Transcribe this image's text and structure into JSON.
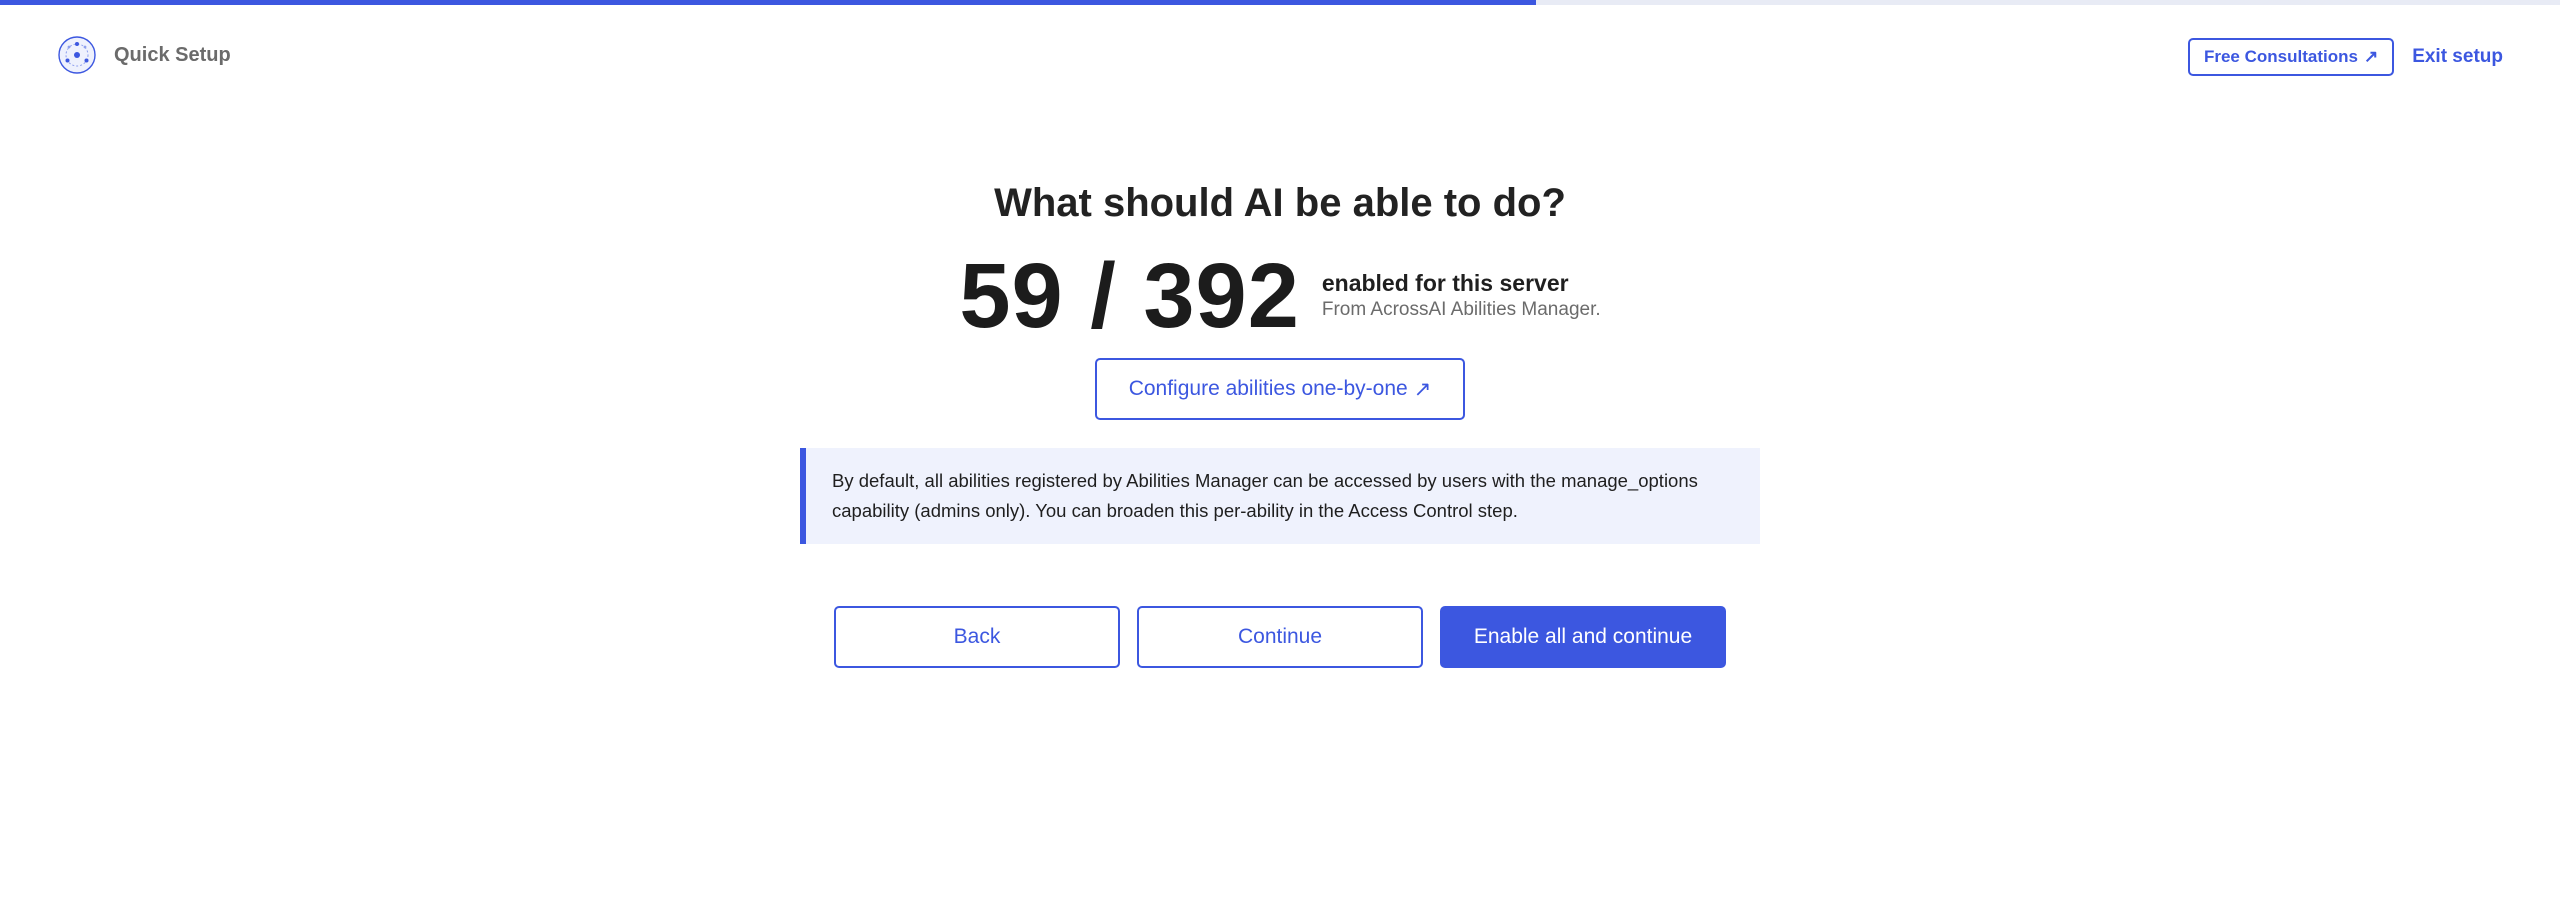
{
  "progress": {
    "fraction": 0.6
  },
  "header": {
    "logo_icon": "network-circle-icon",
    "title": "Quick Setup",
    "consult_label": "Free Consultations",
    "consult_icon": "external-arrow-icon",
    "consult_arrow": "↗",
    "exit_label": "Exit setup"
  },
  "main": {
    "title": "What should AI be able to do?",
    "count": "59 / 392",
    "count_label": "enabled for this server",
    "count_source": "From AcrossAI Abilities Manager.",
    "configure_label": "Configure abilities one-by-one",
    "configure_arrow": "↗",
    "notice": "By default, all abilities registered by Abilities Manager can be accessed by users with the manage_options capability (admins only). You can broaden this per-ability in the Access Control step."
  },
  "actions": {
    "back_label": "Back",
    "continue_label": "Continue",
    "enable_all_label": "Enable all and continue"
  },
  "colors": {
    "accent": "#3c57e0",
    "notice_bg": "#eff2fd",
    "track": "#e8ebf5"
  }
}
